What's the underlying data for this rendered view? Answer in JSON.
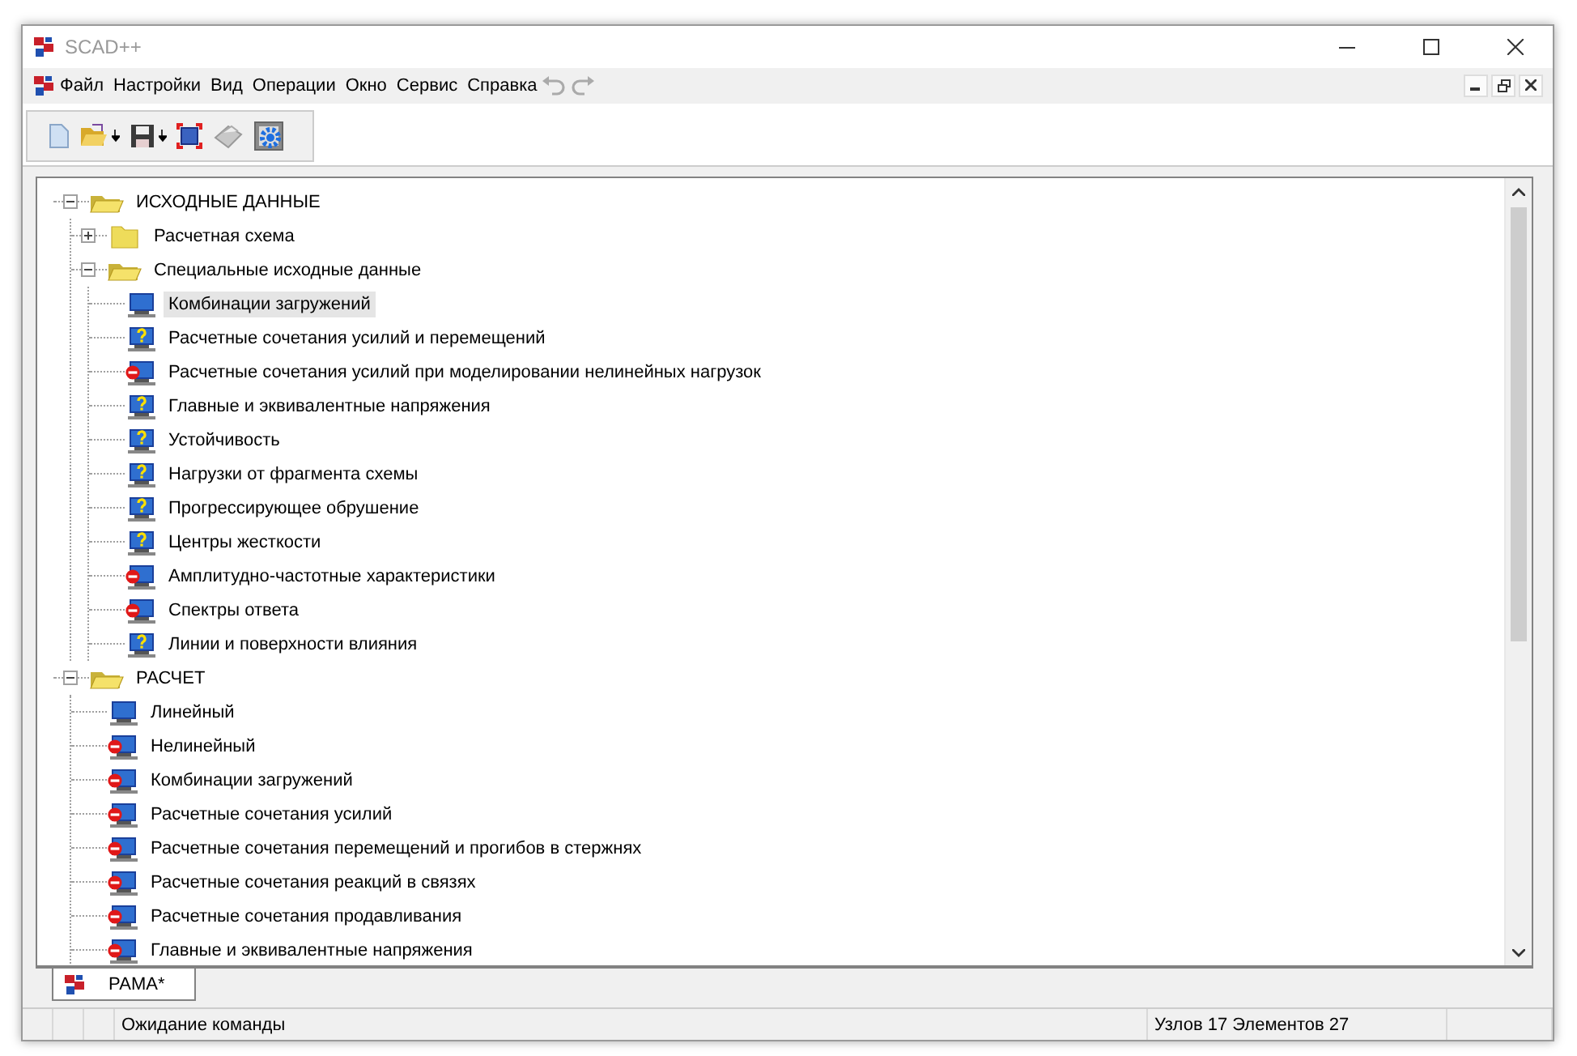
{
  "window": {
    "title": "SCAD++"
  },
  "menu": [
    "Файл",
    "Настройки",
    "Вид",
    "Операции",
    "Окно",
    "Сервис",
    "Справка"
  ],
  "tree": [
    {
      "kind": "folder",
      "label": "ИСХОДНЫЕ ДАННЫЕ",
      "expanded": true,
      "children": [
        {
          "kind": "folder",
          "label": "Расчетная схема",
          "expanded": false
        },
        {
          "kind": "folder",
          "label": "Специальные исходные данные",
          "expanded": true,
          "children": [
            {
              "kind": "ready",
              "label": "Комбинации загружений",
              "selected": true
            },
            {
              "kind": "unknown",
              "label": "Расчетные сочетания усилий и перемещений",
              "selected": false
            },
            {
              "kind": "blocked",
              "label": "Расчетные сочетания усилий при моделировании нелинейных нагрузок",
              "selected": false
            },
            {
              "kind": "unknown",
              "label": "Главные и эквивалентные напряжения",
              "selected": false
            },
            {
              "kind": "unknown",
              "label": "Устойчивость",
              "selected": false
            },
            {
              "kind": "unknown",
              "label": "Нагрузки от фрагмента схемы",
              "selected": false
            },
            {
              "kind": "unknown",
              "label": "Прогрессирующее обрушение",
              "selected": false
            },
            {
              "kind": "unknown",
              "label": "Центры жесткости",
              "selected": false
            },
            {
              "kind": "blocked",
              "label": "Амплитудно-частотные характеристики",
              "selected": false
            },
            {
              "kind": "blocked",
              "label": "Спектры ответа",
              "selected": false
            },
            {
              "kind": "unknown",
              "label": "Линии и поверхности влияния",
              "selected": false
            }
          ]
        }
      ]
    },
    {
      "kind": "folder",
      "label": "РАСЧЕТ",
      "expanded": true,
      "children": [
        {
          "kind": "ready",
          "label": "Линейный",
          "selected": false
        },
        {
          "kind": "blocked",
          "label": "Нелинейный",
          "selected": false
        },
        {
          "kind": "blocked",
          "label": "Комбинации загружений",
          "selected": false
        },
        {
          "kind": "blocked",
          "label": "Расчетные сочетания усилий",
          "selected": false
        },
        {
          "kind": "blocked",
          "label": "Расчетные сочетания перемещений и прогибов в стержнях",
          "selected": false
        },
        {
          "kind": "blocked",
          "label": "Расчетные сочетания реакций в связях",
          "selected": false
        },
        {
          "kind": "blocked",
          "label": "Расчетные сочетания продавливания",
          "selected": false
        },
        {
          "kind": "blocked",
          "label": "Главные и эквивалентные напряжения",
          "selected": false
        }
      ]
    }
  ],
  "tabs": [
    {
      "label": "РАМА*",
      "selected": true
    }
  ],
  "status_bar": {
    "message": "Ожидание команды",
    "counts": "Узлов 17 Элементов 27"
  }
}
